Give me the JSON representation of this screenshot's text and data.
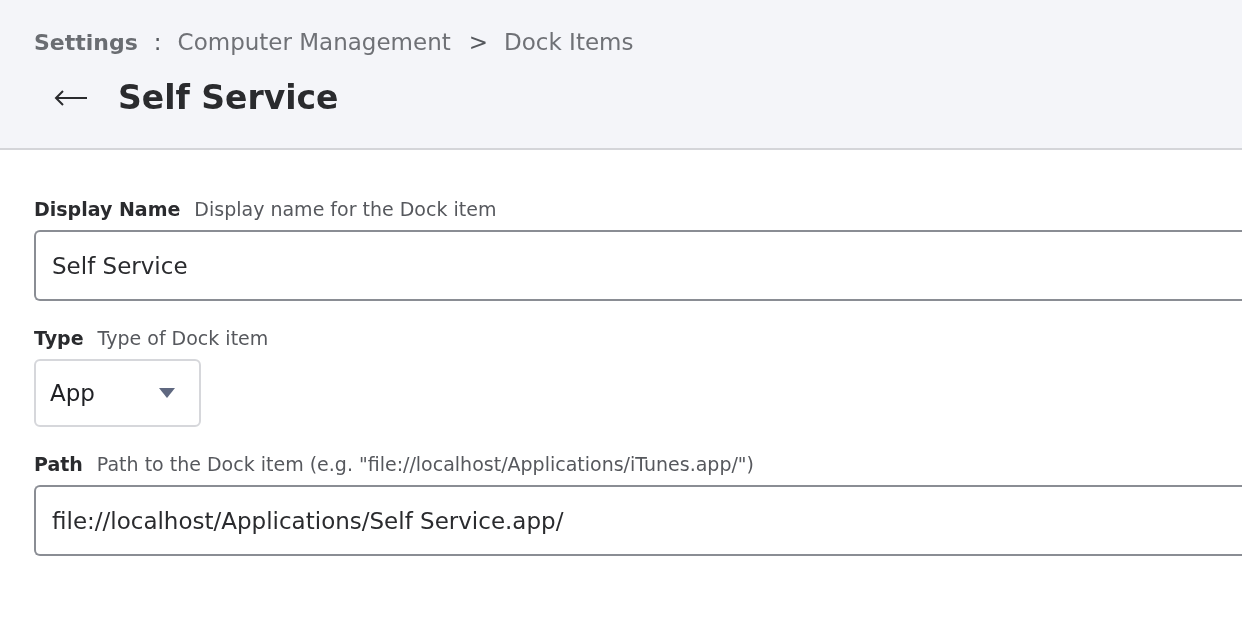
{
  "breadcrumb": [
    {
      "kind": "root",
      "text": "Settings"
    },
    {
      "kind": "separator",
      "text": ":"
    },
    {
      "kind": "link",
      "text": "Computer Management"
    },
    {
      "kind": "separator",
      "text": ">"
    },
    {
      "kind": "current",
      "text": "Dock Items"
    }
  ],
  "page": {
    "title": "Self Service"
  },
  "fields": [
    {
      "kind": "text",
      "label": "Display Name",
      "hint": "Display name for the Dock item",
      "value": "Self Service"
    },
    {
      "kind": "select",
      "label": "Type",
      "hint": "Type of Dock item",
      "value": "App"
    },
    {
      "kind": "text",
      "label": "Path",
      "hint": "Path to the Dock item (e.g. \"file://localhost/Applications/iTunes.app/\")",
      "value": "file://localhost/Applications/Self Service.app/"
    }
  ]
}
